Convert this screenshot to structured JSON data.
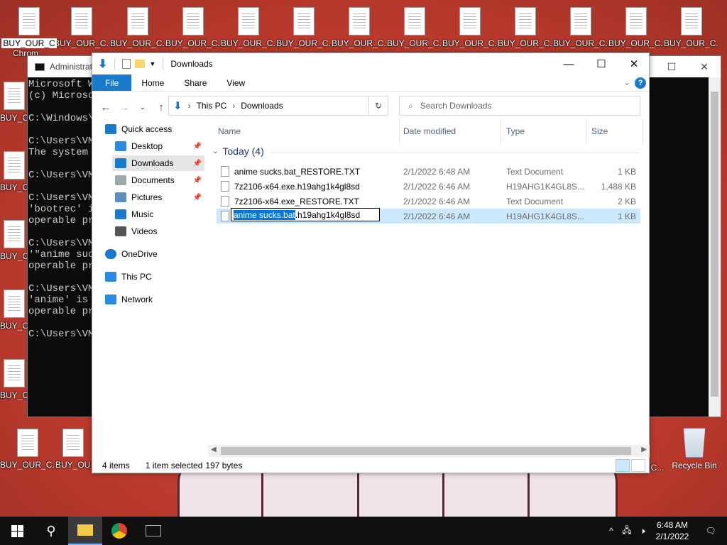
{
  "desktop": {
    "icon_label": "BUY_OUR_C...",
    "icon_label_short": "BUY_OUR_C",
    "icon_label_tiny": "BUY_O",
    "chrome_label": "Chrom...",
    "recycle_label": "Recycle Bin",
    "partial_label": "C..."
  },
  "cmd": {
    "title": "Administrat",
    "lines": [
      "Microsoft W",
      "(c) Microso",
      "",
      "C:\\Windows\\s",
      "",
      "C:\\Users\\VM",
      "The system c",
      "",
      "C:\\Users\\VM",
      "",
      "C:\\Users\\VM",
      "'bootrec' i",
      "operable pro",
      "",
      "C:\\Users\\VM",
      "'\"anime suc",
      "operable pro",
      "",
      "C:\\Users\\VM",
      "'anime' is",
      "operable pro",
      "",
      "C:\\Users\\VM"
    ]
  },
  "explorer": {
    "title": "Downloads",
    "tabs": [
      "File",
      "Home",
      "Share",
      "View"
    ],
    "breadcrumb": [
      "This PC",
      "Downloads"
    ],
    "search_placeholder": "Search Downloads",
    "nav": [
      {
        "label": "Quick access",
        "icon": "star-icon"
      },
      {
        "label": "Desktop",
        "icon": "desktop-icon",
        "pinned": true
      },
      {
        "label": "Downloads",
        "icon": "download-icon",
        "pinned": true,
        "selected": true
      },
      {
        "label": "Documents",
        "icon": "documents-icon",
        "pinned": true
      },
      {
        "label": "Pictures",
        "icon": "pictures-icon",
        "pinned": true
      },
      {
        "label": "Music",
        "icon": "music-icon"
      },
      {
        "label": "Videos",
        "icon": "videos-icon"
      },
      {
        "label": "OneDrive",
        "icon": "cloud-icon"
      },
      {
        "label": "This PC",
        "icon": "computer-icon"
      },
      {
        "label": "Network",
        "icon": "network-icon"
      }
    ],
    "columns": [
      "Name",
      "Date modified",
      "Type",
      "Size"
    ],
    "group": "Today (4)",
    "files": [
      {
        "name": "anime sucks.bat_RESTORE.TXT",
        "date": "2/1/2022 6:48 AM",
        "type": "Text Document",
        "size": "1 KB"
      },
      {
        "name": "7z2106-x64.exe.h19ahg1k4gl8sd",
        "date": "2/1/2022 6:46 AM",
        "type": "H19AHG1K4GL8S...",
        "size": "1,488 KB"
      },
      {
        "name": "7z2106-x64.exe_RESTORE.TXT",
        "date": "2/1/2022 6:46 AM",
        "type": "Text Document",
        "size": "2 KB"
      },
      {
        "name": "anime sucks.bat.h19ahg1k4gl8sd",
        "date": "2/1/2022 6:46 AM",
        "type": "H19AHG1K4GL8S...",
        "size": "1 KB"
      }
    ],
    "rename": {
      "selected": "anime sucks.bat",
      "rest": ".h19ahg1k4gl8sd"
    },
    "status": {
      "count": "4 items",
      "selected": "1 item selected",
      "bytes": "197 bytes"
    }
  },
  "taskbar": {
    "time": "6:48 AM",
    "date": "2/1/2022"
  }
}
